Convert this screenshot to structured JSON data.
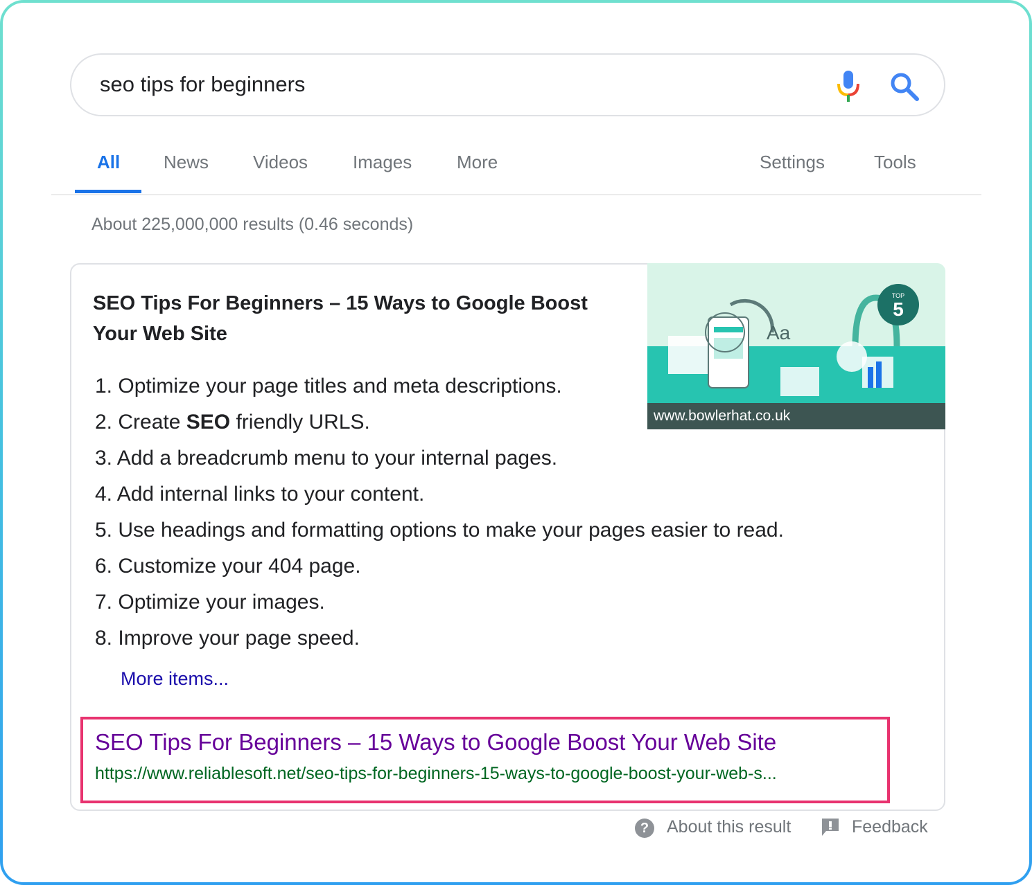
{
  "search": {
    "query": "seo tips for beginners",
    "mic_icon": "microphone-icon",
    "search_icon": "magnifier-icon"
  },
  "tabs": [
    {
      "label": "All",
      "active": true
    },
    {
      "label": "News",
      "active": false
    },
    {
      "label": "Videos",
      "active": false
    },
    {
      "label": "Images",
      "active": false
    },
    {
      "label": "More",
      "active": false
    }
  ],
  "tools": {
    "settings": "Settings",
    "tools": "Tools"
  },
  "result_stats": "About 225,000,000 results (0.46 seconds)",
  "snippet": {
    "title": "SEO Tips For Beginners – 15 Ways to Google Boost Your Web Site",
    "items": [
      {
        "num": "1.",
        "pre": "Optimize your page titles and meta descriptions.",
        "bold": "",
        "post": ""
      },
      {
        "num": "2.",
        "pre": "Create ",
        "bold": "SEO",
        "post": " friendly URLS."
      },
      {
        "num": "3.",
        "pre": "Add a breadcrumb menu to your internal pages.",
        "bold": "",
        "post": ""
      },
      {
        "num": "4.",
        "pre": "Add internal links to your content.",
        "bold": "",
        "post": ""
      },
      {
        "num": "5.",
        "pre": "Use headings and formatting options to make your pages easier to read.",
        "bold": "",
        "post": ""
      },
      {
        "num": "6.",
        "pre": "Customize your 404 page.",
        "bold": "",
        "post": ""
      },
      {
        "num": "7.",
        "pre": "Optimize your images.",
        "bold": "",
        "post": ""
      },
      {
        "num": "8.",
        "pre": "Improve your page speed.",
        "bold": "",
        "post": ""
      }
    ],
    "more_items": "More items...",
    "image_caption": "www.bowlerhat.co.uk",
    "image_art_text": "Aa",
    "image_badge_top": "TOP",
    "image_badge_number": "5"
  },
  "result": {
    "title": "SEO Tips For Beginners – 15 Ways to Google Boost Your Web Site",
    "url": "https://www.reliablesoft.net/seo-tips-for-beginners-15-ways-to-google-boost-your-web-s..."
  },
  "footer": {
    "about": "About this result",
    "feedback": "Feedback"
  },
  "colors": {
    "accent_blue": "#1a73e8",
    "visited_link": "#660099",
    "url_green": "#006621",
    "highlight_border": "#e8336f"
  }
}
